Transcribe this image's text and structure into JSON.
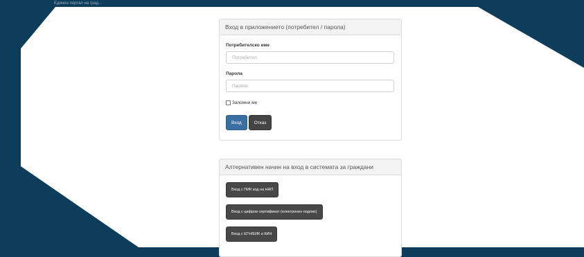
{
  "header": {
    "top_text": "Единен портал на град..."
  },
  "login_panel": {
    "title": "Вход в приложението (потребител / парола)",
    "username_label": "Потребителско име",
    "username_placeholder": "Потребител",
    "password_label": "Парола",
    "password_placeholder": "Парола",
    "remember_label": "Запомни ме",
    "login_button": "Вход",
    "cancel_button": "Отказ"
  },
  "alt_panel": {
    "title": "Алтернативен начин на вход в системата за граждани",
    "buttons": [
      "Вход с ПИК код на НАП",
      "Вход с цифров сертификат (електронен подпис)",
      "Вход с ЕГН/ЕИК и КИН"
    ]
  },
  "colors": {
    "background": "#0e3d5c",
    "primary": "#3a6fa3",
    "dark_button": "#444444"
  }
}
